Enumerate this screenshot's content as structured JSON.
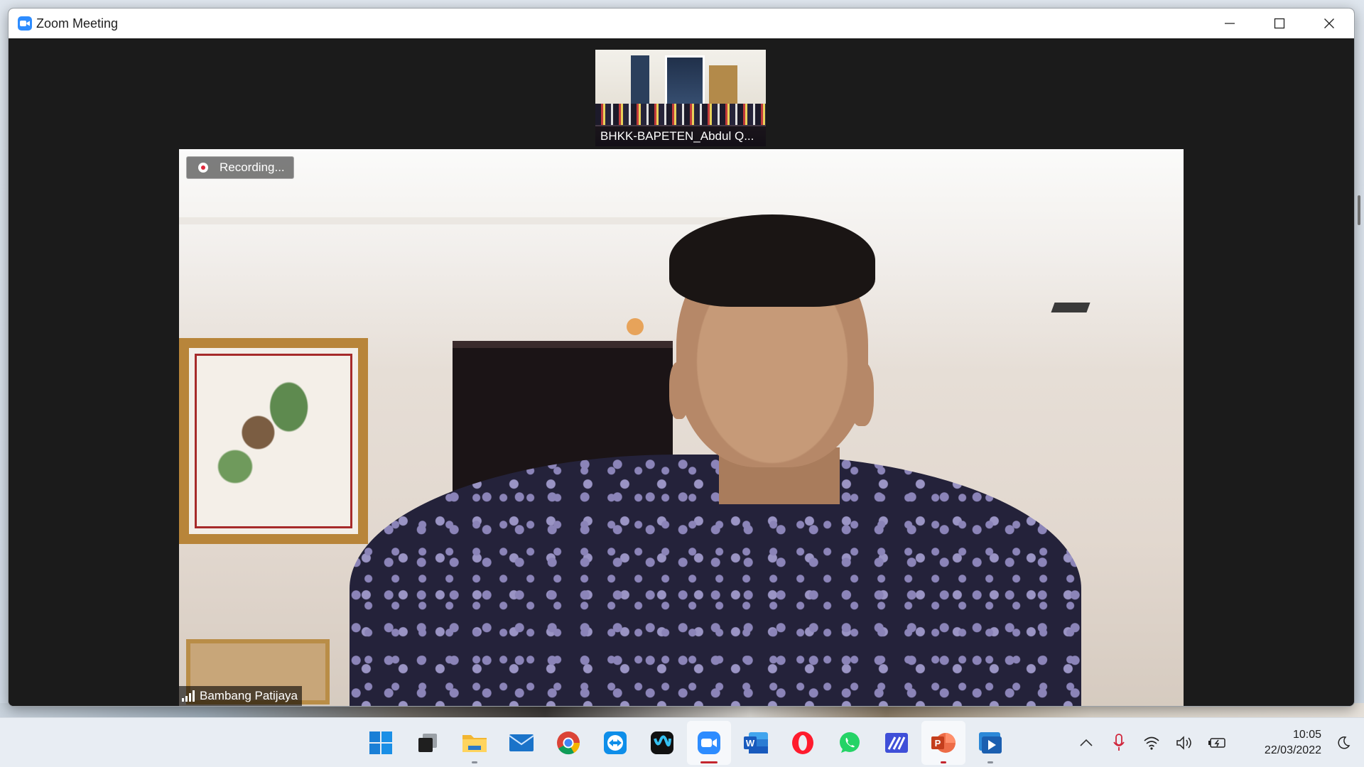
{
  "window": {
    "title": "Zoom Meeting",
    "controls": {
      "minimize": "minimize-icon",
      "maximize": "maximize-icon",
      "close": "close-icon"
    }
  },
  "meeting": {
    "thumbnail_participant": "BHKK-BAPETEN_Abdul Q...",
    "recording_label": "Recording...",
    "active_speaker": "Bambang Patijaya"
  },
  "taskbar": {
    "apps": [
      {
        "name": "windows-start",
        "icon": "windows-logo-icon"
      },
      {
        "name": "task-view",
        "icon": "task-view-icon"
      },
      {
        "name": "file-explorer",
        "icon": "folder-icon"
      },
      {
        "name": "mail",
        "icon": "mail-icon"
      },
      {
        "name": "chrome",
        "icon": "chrome-icon"
      },
      {
        "name": "teamviewer",
        "icon": "teamviewer-icon"
      },
      {
        "name": "webex",
        "icon": "webex-icon"
      },
      {
        "name": "zoom",
        "icon": "zoom-icon"
      },
      {
        "name": "word",
        "icon": "word-icon"
      },
      {
        "name": "opera",
        "icon": "opera-icon"
      },
      {
        "name": "whatsapp",
        "icon": "whatsapp-icon"
      },
      {
        "name": "editor",
        "icon": "editor-icon"
      },
      {
        "name": "powerpoint",
        "icon": "powerpoint-icon"
      },
      {
        "name": "media-player",
        "icon": "media-player-icon"
      }
    ],
    "time": "10:05",
    "date": "22/03/2022"
  },
  "colors": {
    "zoom_blue": "#2d8cff",
    "recording_red": "#e0283b",
    "taskbar_bg": "#e8edf3",
    "meeting_bg": "#1b1b1b"
  }
}
